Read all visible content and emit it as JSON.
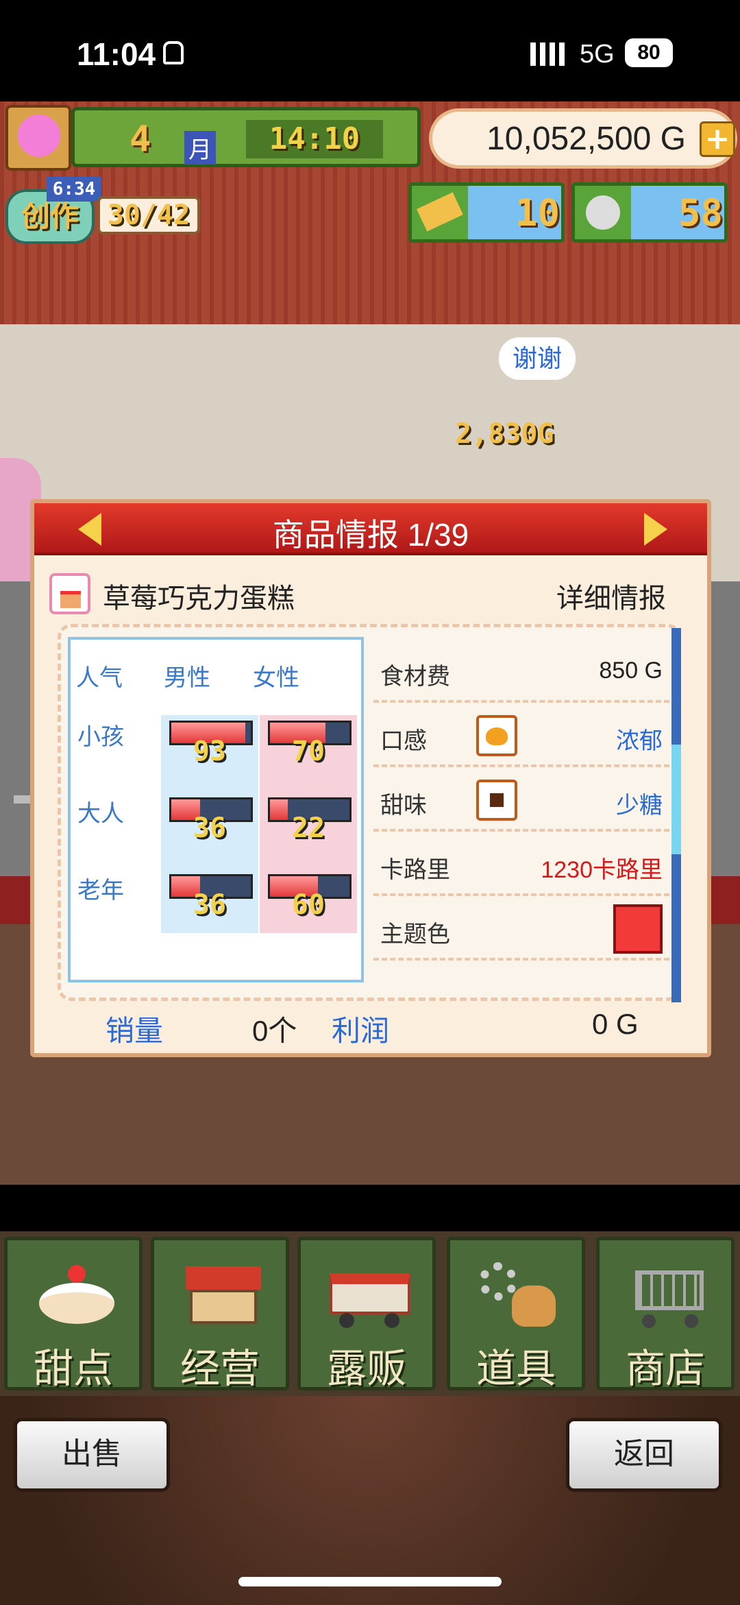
{
  "status_bar": {
    "time": "11:04",
    "network": "5G",
    "battery": "80"
  },
  "hud": {
    "month": "4",
    "month_label": "月",
    "clock": "14:10",
    "money": "10,052,500 G",
    "money_plus": "+",
    "create_timer": "6:34",
    "create_label": "创作",
    "create_count": "30/42",
    "gold_bars": "10",
    "silver_medals": "58"
  },
  "scene": {
    "speech_bubble": "谢谢",
    "earning_popup": "2,830G"
  },
  "panel": {
    "title": "商品情报 1/39",
    "product_name": "草莓巧克力蛋糕",
    "detail_link": "详细情报",
    "popularity": {
      "header": "人气",
      "male": "男性",
      "female": "女性",
      "rows": [
        {
          "label": "小孩",
          "male": 93,
          "female": 70
        },
        {
          "label": "大人",
          "male": 36,
          "female": 22
        },
        {
          "label": "老年",
          "male": 36,
          "female": 60
        }
      ]
    },
    "stats": {
      "ingredient_cost_label": "食材费",
      "ingredient_cost": "850 G",
      "texture_label": "口感",
      "texture": "浓郁",
      "sweetness_label": "甜味",
      "sweetness": "少糖",
      "calories_label": "卡路里",
      "calories": "1230卡路里",
      "theme_color_label": "主题色",
      "theme_color": "#f23a3a"
    },
    "sales_label": "销量",
    "sales": "0个",
    "profit_label": "利润",
    "profit": "0 G"
  },
  "nav": [
    {
      "label": "甜点",
      "icon": "cake-icon"
    },
    {
      "label": "经营",
      "icon": "shop-building-icon"
    },
    {
      "label": "露贩",
      "icon": "food-truck-icon"
    },
    {
      "label": "道具",
      "icon": "gear-bag-icon"
    },
    {
      "label": "商店",
      "icon": "shopping-cart-icon"
    }
  ],
  "buttons": {
    "sell": "出售",
    "back": "返回"
  }
}
